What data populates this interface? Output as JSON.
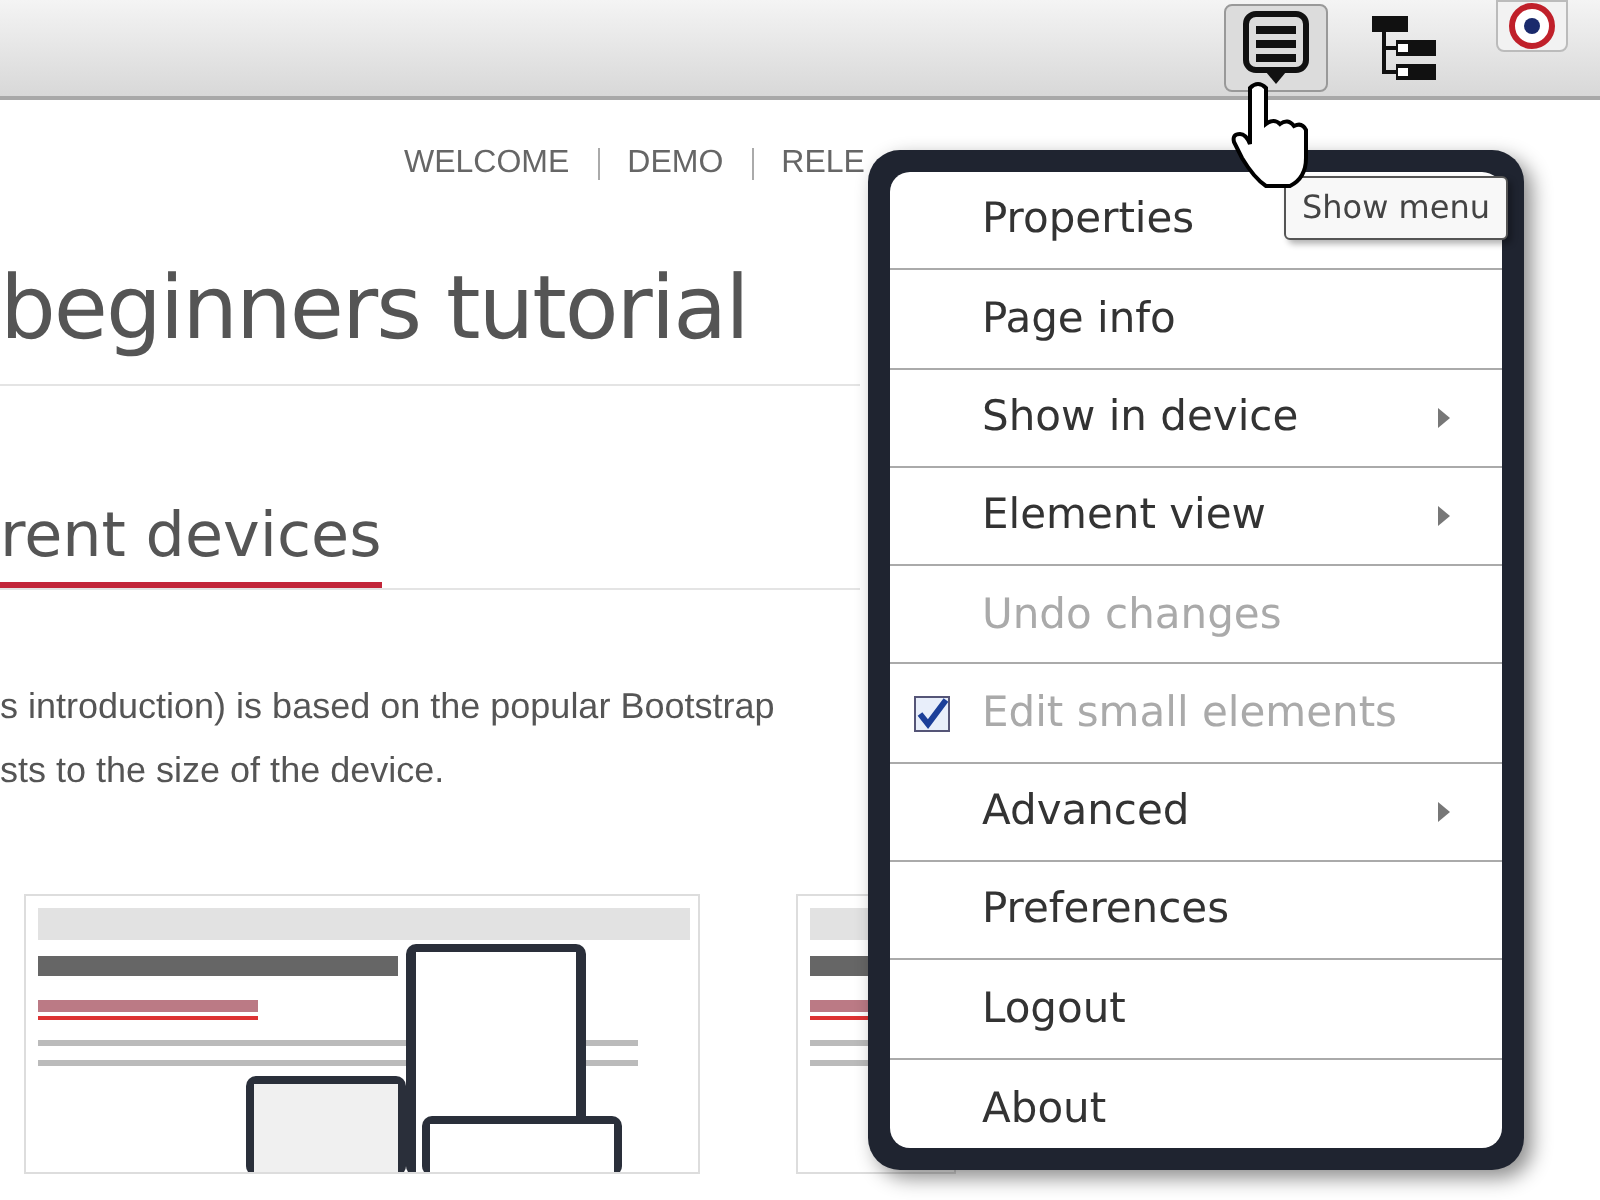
{
  "toolbar": {
    "buttons": [
      {
        "kind": "menu",
        "selected": true
      },
      {
        "kind": "tree",
        "selected": false
      }
    ]
  },
  "nav": [
    "WELCOME",
    "DEMO",
    "RELE"
  ],
  "heading": "beginners tutorial",
  "subheading": "rent devices",
  "paragraph": [
    "s introduction) is based on the popular Bootstrap",
    "sts to the size of the device."
  ],
  "thumbnails": [
    {
      "kind": "picture"
    },
    {
      "kind": "picture"
    }
  ],
  "menu": {
    "items": [
      {
        "label": "Properties",
        "submenu": false,
        "disabled": false,
        "checked": false
      },
      {
        "label": "Page info",
        "submenu": false,
        "disabled": false,
        "checked": false
      },
      {
        "label": "Show in device",
        "submenu": true,
        "disabled": false,
        "checked": false
      },
      {
        "label": "Element view",
        "submenu": true,
        "disabled": false,
        "checked": false
      },
      {
        "label": "Undo changes",
        "submenu": false,
        "disabled": true,
        "checked": false
      },
      {
        "label": "Edit small elements",
        "submenu": false,
        "disabled": true,
        "checked": true
      },
      {
        "label": "Advanced",
        "submenu": true,
        "disabled": false,
        "checked": false
      },
      {
        "label": "Preferences",
        "submenu": false,
        "disabled": false,
        "checked": false
      },
      {
        "label": "Logout",
        "submenu": false,
        "disabled": false,
        "checked": false
      },
      {
        "label": "About",
        "submenu": false,
        "disabled": false,
        "checked": false
      }
    ]
  },
  "tooltip": "Show menu"
}
